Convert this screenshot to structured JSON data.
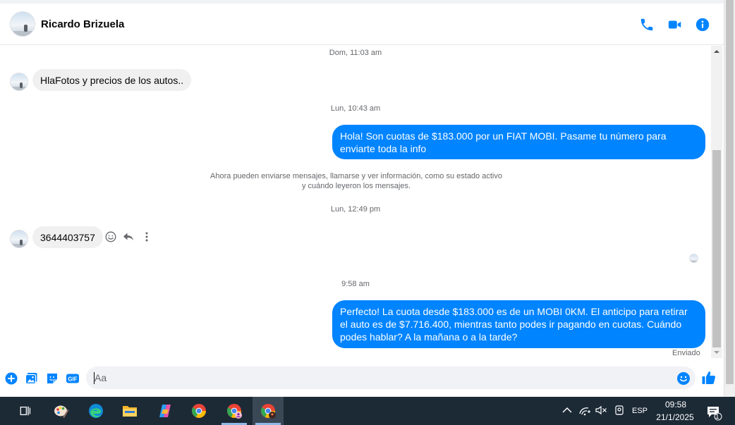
{
  "header": {
    "contact_name": "Ricardo Brizuela",
    "icons": [
      "phone-icon",
      "video-camera-icon",
      "info-icon"
    ],
    "accent_color": "#0084ff"
  },
  "conversation": {
    "timestamps": [
      "Dom, 11:03 am",
      "Lun, 10:43 am",
      "Lun, 12:49 pm",
      "9:58 am"
    ],
    "messages": [
      {
        "direction": "incoming",
        "text": "HlaFotos y precios de los autos.."
      },
      {
        "direction": "outgoing",
        "text": "Hola! Son cuotas de $183.000 por un FIAT MOBI. Pasame tu número para enviarte toda la info"
      },
      {
        "direction": "incoming",
        "text": "3644403757"
      },
      {
        "direction": "outgoing",
        "text": "Perfecto! La cuota desde $183.000 es de un MOBI 0KM. El anticipo para retirar el auto es de $7.716.400, mientras tanto podes ir pagando en cuotas. Cuándo podes hablar? A la mañana o a la tarde?"
      }
    ],
    "system_message_line1": "Ahora pueden enviarse mensajes, llamarse y ver información, como su estado activo",
    "system_message_line2": "y cuándo leyeron los mensajes.",
    "message_actions": [
      "react-icon",
      "reply-icon",
      "more-options-icon"
    ],
    "sent_status": "Enviado"
  },
  "composer": {
    "placeholder": "Aa",
    "left_icons": [
      "add-icon",
      "image-icon",
      "sticker-icon",
      "gif-icon"
    ],
    "gif_label": "GIF",
    "right_icons": [
      "emoji-icon",
      "like-icon"
    ]
  },
  "taskbar": {
    "apps": [
      "task-view-icon",
      "paint-icon",
      "edge-icon",
      "file-explorer-icon",
      "copilot-icon",
      "chrome-icon",
      "chrome-profile-icon",
      "chrome-active-icon"
    ],
    "language": "ESP",
    "time": "09:58",
    "date": "21/1/2025",
    "notification_count": "1",
    "bg_color": "#1c2a36"
  }
}
